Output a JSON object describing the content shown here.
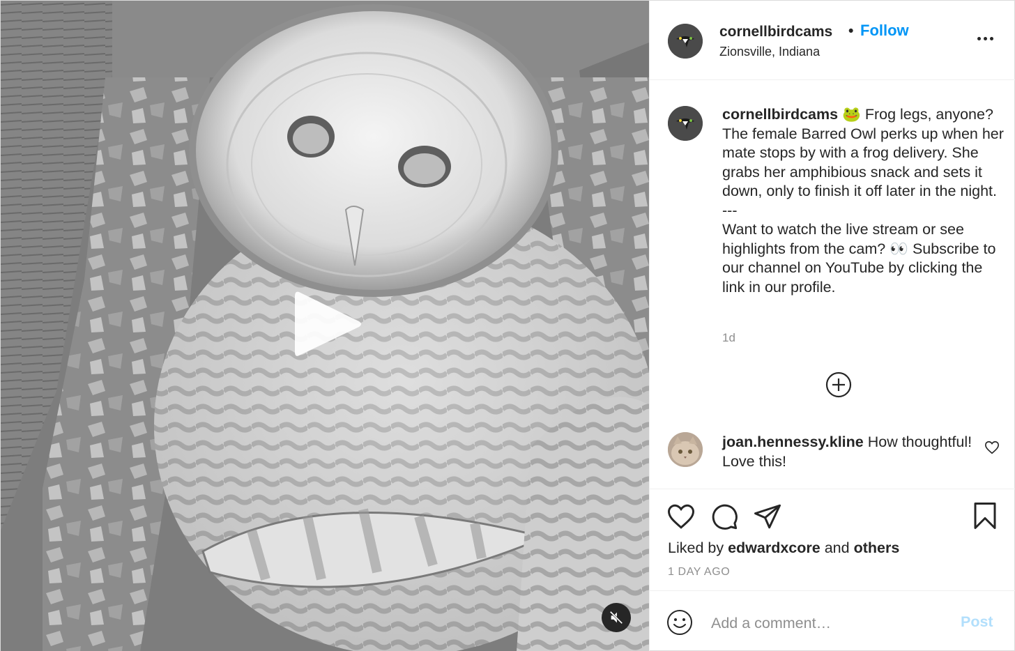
{
  "media": {
    "type": "video",
    "play_icon": "play-icon",
    "mute_icon": "volume-muted-icon"
  },
  "header": {
    "username": "cornellbirdcams",
    "separator": "•",
    "follow_label": "Follow",
    "location": "Zionsville, Indiana",
    "more_icon": "more-horizontal-icon"
  },
  "caption": {
    "username": "cornellbirdcams",
    "emoji": "🐸",
    "lines": [
      "Frog legs, anyone? The female Barred Owl perks up when her mate stops by with a frog delivery. She grabs her amphibious snack and sets it down, only to finish it off later in the night.",
      "---",
      "Want to watch the live stream or see highlights from the cam? 👀 Subscribe to our channel on YouTube by clicking the link in our profile."
    ],
    "time": "1d"
  },
  "load_more_icon": "plus-circle-icon",
  "comments": [
    {
      "username": "joan.hennessy.kline",
      "text": "How thoughtful! Love this!",
      "like_icon": "heart-icon"
    }
  ],
  "actions": {
    "like_icon": "heart-icon",
    "comment_icon": "comment-icon",
    "share_icon": "paper-plane-icon",
    "save_icon": "bookmark-icon"
  },
  "likes": {
    "prefix": "Liked by",
    "user": "edwardxcore",
    "conjunction": "and",
    "others": "others"
  },
  "posted_ago": "1 DAY AGO",
  "add_comment": {
    "emoji_icon": "smiley-icon",
    "placeholder": "Add a comment…",
    "post_label": "Post"
  },
  "colors": {
    "link_blue": "#0095f6",
    "post_disabled": "#b2dffc",
    "text": "#262626",
    "muted": "#8e8e8e",
    "border": "#efefef"
  }
}
